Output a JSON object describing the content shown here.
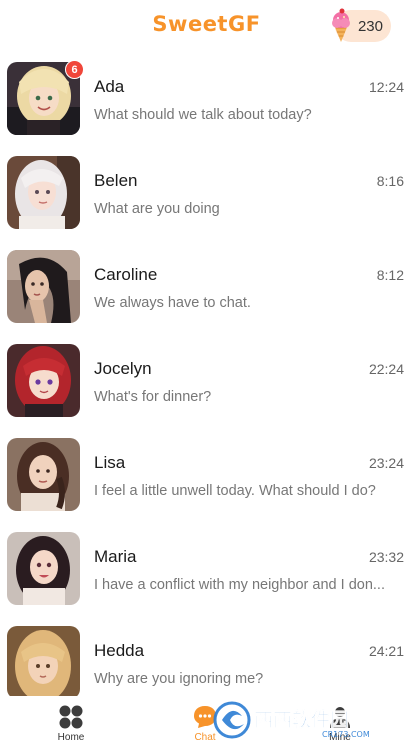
{
  "header": {
    "title": "SweetGF",
    "coins": "230",
    "coin_icon": "ice-cream-icon"
  },
  "chats": [
    {
      "name": "Ada",
      "time": "12:24",
      "preview": "What should we talk about today?",
      "unread": "6"
    },
    {
      "name": "Belen",
      "time": "8:16",
      "preview": "What are you doing"
    },
    {
      "name": "Caroline",
      "time": "8:12",
      "preview": "We always have to chat."
    },
    {
      "name": "Jocelyn",
      "time": "22:24",
      "preview": "What's for dinner?"
    },
    {
      "name": "Lisa",
      "time": "23:24",
      "preview": "I feel a little unwell today. What should I do?"
    },
    {
      "name": "Maria",
      "time": "23:32",
      "preview": "I have a conflict with my neighbor and I don..."
    },
    {
      "name": "Hedda",
      "time": "24:21",
      "preview": "Why are you ignoring me?"
    }
  ],
  "nav": {
    "home_label": "Home",
    "chat_label": "Chat",
    "mine_label": "Mine"
  },
  "watermark": {
    "main": "西西软件园",
    "sub": "CR173.COM"
  },
  "colors": {
    "accent": "#f7932a",
    "badge": "#f0463a",
    "coin_pill": "#fde5d3"
  }
}
